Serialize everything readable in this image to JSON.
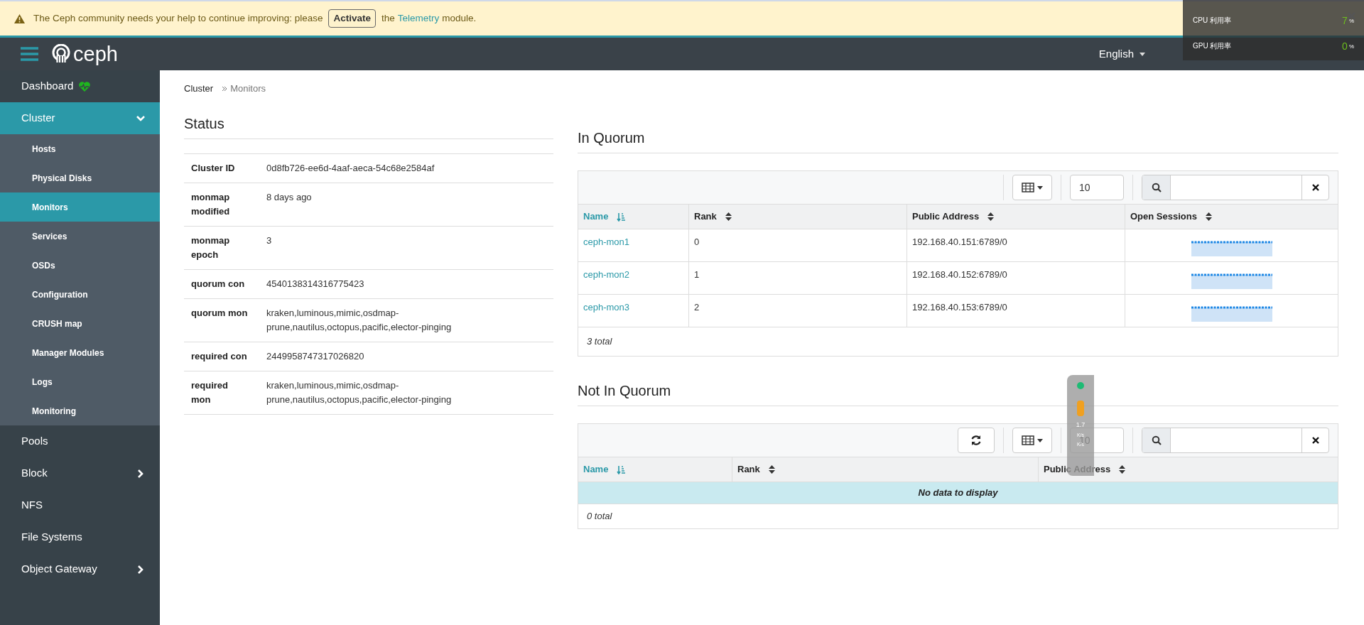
{
  "banner": {
    "before": "The Ceph community needs your help to continue improving: please",
    "button": "Activate",
    "middle": "the",
    "link": "Telemetry",
    "after": "module."
  },
  "navbar": {
    "logo": "ceph",
    "language": "English"
  },
  "sidebar": [
    {
      "label": "Dashboard",
      "selected": false,
      "healthy": true
    },
    {
      "label": "Cluster",
      "selected": true,
      "expanded": true,
      "children": [
        {
          "label": "Hosts",
          "selected": false
        },
        {
          "label": "Physical Disks",
          "selected": false
        },
        {
          "label": "Monitors",
          "selected": true
        },
        {
          "label": "Services",
          "selected": false
        },
        {
          "label": "OSDs",
          "selected": false
        },
        {
          "label": "Configuration",
          "selected": false
        },
        {
          "label": "CRUSH map",
          "selected": false
        },
        {
          "label": "Manager Modules",
          "selected": false
        },
        {
          "label": "Logs",
          "selected": false
        },
        {
          "label": "Monitoring",
          "selected": false
        }
      ]
    },
    {
      "label": "Pools",
      "selected": false
    },
    {
      "label": "Block",
      "selected": false,
      "expanded": false
    },
    {
      "label": "NFS",
      "selected": false
    },
    {
      "label": "File Systems",
      "selected": false
    },
    {
      "label": "Object Gateway",
      "selected": false,
      "expanded": false
    }
  ],
  "breadcrumb": [
    "Cluster",
    "Monitors"
  ],
  "status": {
    "title": "Status",
    "rows": [
      {
        "label": "Cluster ID",
        "value": "0d8fb726-ee6d-4aaf-aeca-54c68e2584af"
      },
      {
        "label": "monmap modified",
        "value": "8 days ago"
      },
      {
        "label": "monmap epoch",
        "value": "3"
      },
      {
        "label": "quorum con",
        "value": "4540138314316775423"
      },
      {
        "label": "quorum mon",
        "value": "kraken,luminous,mimic,osdmap-prune,nautilus,octopus,pacific,elector-pinging"
      },
      {
        "label": "required con",
        "value": "2449958747317026820"
      },
      {
        "label": "required mon",
        "value": "kraken,luminous,mimic,osdmap-prune,nautilus,octopus,pacific,elector-pinging"
      }
    ]
  },
  "in_quorum": {
    "title": "In Quorum",
    "page_size": "10",
    "columns": [
      {
        "label": "Name",
        "sorted": true
      },
      {
        "label": "Rank",
        "sorted": false
      },
      {
        "label": "Public Address",
        "sorted": false
      },
      {
        "label": "Open Sessions",
        "sorted": false
      }
    ],
    "rows": [
      {
        "name": "ceph-mon1",
        "rank": "0",
        "address": "192.168.40.151:6789/0"
      },
      {
        "name": "ceph-mon2",
        "rank": "1",
        "address": "192.168.40.152:6789/0"
      },
      {
        "name": "ceph-mon3",
        "rank": "2",
        "address": "192.168.40.153:6789/0"
      }
    ],
    "footer": "3 total"
  },
  "not_in_quorum": {
    "title": "Not In Quorum",
    "page_size": "10",
    "columns": [
      {
        "label": "Name",
        "sorted": true
      },
      {
        "label": "Rank",
        "sorted": false
      },
      {
        "label": "Public Address",
        "sorted": false
      }
    ],
    "empty": "No data to display",
    "footer": "0 total"
  },
  "perf_overlay": {
    "rows": [
      {
        "label": "CPU 利用率",
        "value": "7",
        "unit": "%"
      },
      {
        "label": "GPU 利用率",
        "value": "0",
        "unit": "%"
      }
    ]
  },
  "net_widget": {
    "reading": "1.7",
    "units": [
      "K/s",
      "K/s"
    ]
  }
}
